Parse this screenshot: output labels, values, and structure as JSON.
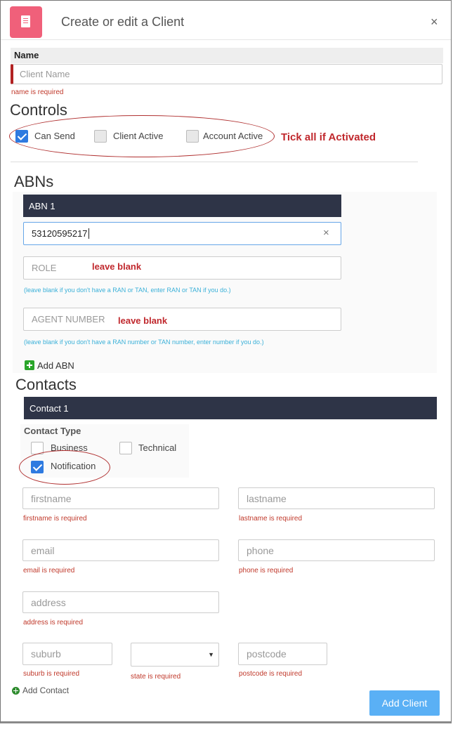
{
  "header": {
    "title": "Create or edit a Client",
    "close_icon": "×"
  },
  "name": {
    "label": "Name",
    "placeholder": "Client Name",
    "error": "name is required"
  },
  "controls": {
    "heading": "Controls",
    "checkboxes": [
      {
        "label": "Can Send",
        "checked": true
      },
      {
        "label": "Client Active",
        "checked": false
      },
      {
        "label": "Account Active",
        "checked": false
      }
    ],
    "annotation": "Tick all if Activated"
  },
  "abns": {
    "heading": "ABNs",
    "bar_title": "ABN 1",
    "abn_value": "53120595217",
    "clear_icon": "×",
    "role_placeholder": "ROLE",
    "role_annotation": "leave blank",
    "role_hint": "(leave blank if you don't have a RAN or TAN, enter RAN or TAN if you do.)",
    "agent_placeholder": "AGENT NUMBER",
    "agent_annotation": "leave blank",
    "agent_hint": "(leave blank if you don't have a RAN number or TAN number, enter number if you do.)",
    "add_label": "Add ABN"
  },
  "contacts": {
    "heading": "Contacts",
    "bar_title": "Contact 1",
    "type_label": "Contact Type",
    "types": [
      {
        "label": "Business",
        "checked": false
      },
      {
        "label": "Technical",
        "checked": false
      },
      {
        "label": "Notification",
        "checked": true
      }
    ],
    "fields": {
      "firstname": {
        "placeholder": "firstname",
        "error": "firstname is required"
      },
      "lastname": {
        "placeholder": "lastname",
        "error": "lastname is required"
      },
      "email": {
        "placeholder": "email",
        "error": "email is required"
      },
      "phone": {
        "placeholder": "phone",
        "error": "phone is required"
      },
      "address": {
        "placeholder": "address",
        "error": "address is required"
      },
      "suburb": {
        "placeholder": "suburb",
        "error": "suburb is required"
      },
      "state": {
        "value": "",
        "error": "state is required"
      },
      "postcode": {
        "placeholder": "postcode",
        "error": "postcode is required"
      }
    },
    "add_label": "Add Contact"
  },
  "footer": {
    "submit_label": "Add Client"
  },
  "colors": {
    "accent": "#5ab0f5",
    "header_icon": "#f0607a",
    "dark_bar": "#2e3447",
    "error": "#c0392b",
    "annotation": "#c0282d",
    "hint": "#3ab0d8",
    "checkbox_checked": "#2e7ae0"
  }
}
